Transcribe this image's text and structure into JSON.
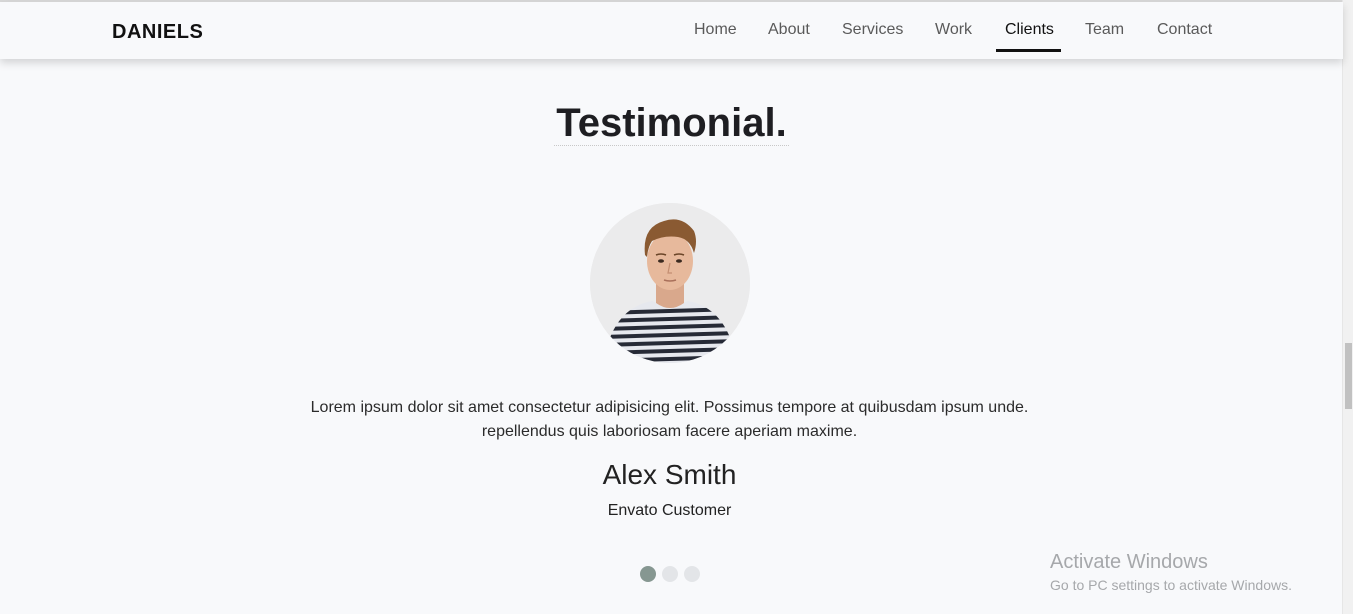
{
  "brand": "DANIELS",
  "nav": {
    "items": [
      {
        "label": "Home"
      },
      {
        "label": "About"
      },
      {
        "label": "Services"
      },
      {
        "label": "Work"
      },
      {
        "label": "Clients"
      },
      {
        "label": "Team"
      },
      {
        "label": "Contact"
      }
    ],
    "active": "Clients"
  },
  "section": {
    "title": "Testimonial."
  },
  "testimonial": {
    "avatar_icon": "person-photo",
    "text_line1": "Lorem ipsum dolor sit amet consectetur adipisicing elit. Possimus tempore at quibusdam ipsum unde.",
    "text_line2": "repellendus quis laboriosam facere aperiam maxime.",
    "name": "Alex Smith",
    "role": "Envato Customer"
  },
  "carousel": {
    "slides": 3,
    "active_index": 0
  },
  "watermark": {
    "title": "Activate Windows",
    "subtitle": "Go to PC settings to activate Windows."
  },
  "colors": {
    "background": "#f8f9fb",
    "active_dot": "#869791",
    "inactive_dot": "#e3e5e8"
  }
}
